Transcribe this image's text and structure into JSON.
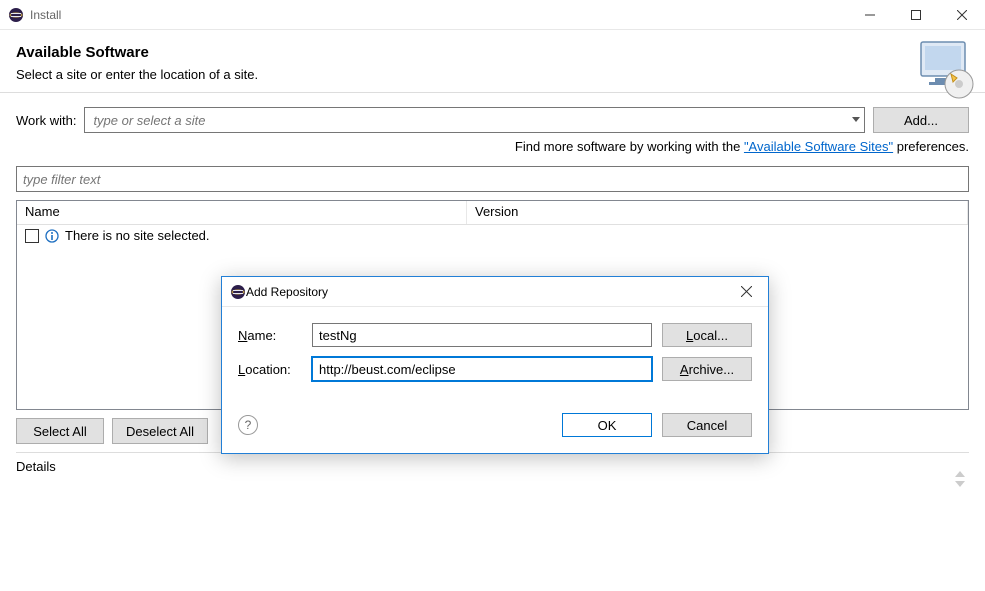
{
  "window": {
    "title": "Install"
  },
  "header": {
    "title": "Available Software",
    "subtitle": "Select a site or enter the location of a site."
  },
  "workwith": {
    "label": "Work with:",
    "placeholder": "type or select a site",
    "add_button": "Add..."
  },
  "helper": {
    "prefix": "Find more software by working with the ",
    "link": "\"Available Software Sites\"",
    "suffix": " preferences."
  },
  "filter": {
    "placeholder": "type filter text"
  },
  "table": {
    "columns": {
      "name": "Name",
      "version": "Version"
    },
    "empty_message": "There is no site selected."
  },
  "buttons": {
    "select_all": "Select All",
    "deselect_all": "Deselect All"
  },
  "details": {
    "label": "Details"
  },
  "modal": {
    "title": "Add Repository",
    "name_label_prefix": "N",
    "name_label_rest": "ame:",
    "name_value": "testNg",
    "location_label_prefix": "L",
    "location_label_rest": "ocation:",
    "location_value": "http://beust.com/eclipse",
    "local_button_prefix": "L",
    "local_button_rest": "ocal...",
    "archive_button_prefix": "A",
    "archive_button_rest": "rchive...",
    "ok": "OK",
    "cancel": "Cancel"
  }
}
